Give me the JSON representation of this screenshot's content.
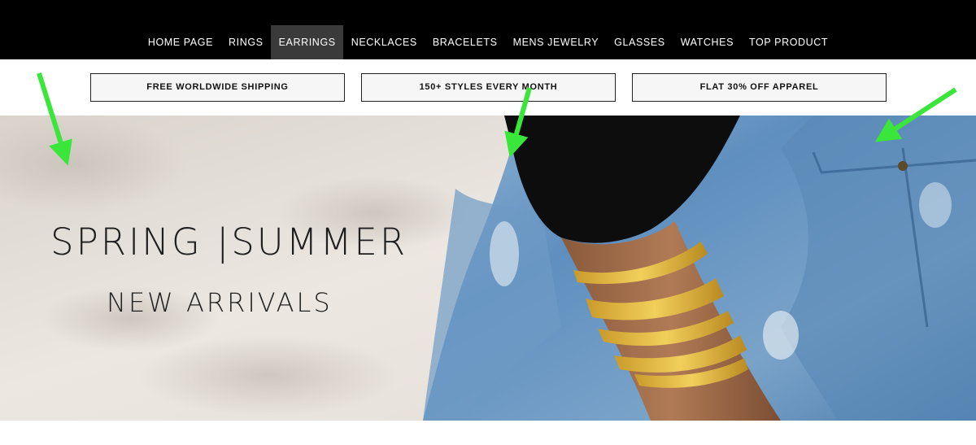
{
  "nav": {
    "items": [
      {
        "label": "HOME PAGE",
        "active": false
      },
      {
        "label": "RINGS",
        "active": false
      },
      {
        "label": "EARRINGS",
        "active": true
      },
      {
        "label": "NECKLACES",
        "active": false
      },
      {
        "label": "BRACELETS",
        "active": false
      },
      {
        "label": "MENS JEWELRY",
        "active": false
      },
      {
        "label": "GLASSES",
        "active": false
      },
      {
        "label": "WATCHES",
        "active": false
      },
      {
        "label": "TOP PRODUCT",
        "active": false
      }
    ]
  },
  "promos": [
    {
      "label": "FREE WORLDWIDE SHIPPING"
    },
    {
      "label": "150+ STYLES EVERY MONTH"
    },
    {
      "label": "FLAT 30% OFF APPAREL"
    }
  ],
  "hero": {
    "headline": "SPRING |SUMMER",
    "subhead": "NEW ARRIVALS"
  },
  "colors": {
    "nav_bg": "#000000",
    "nav_active": "#3a3a3a",
    "annotation_arrow": "#39e639"
  }
}
